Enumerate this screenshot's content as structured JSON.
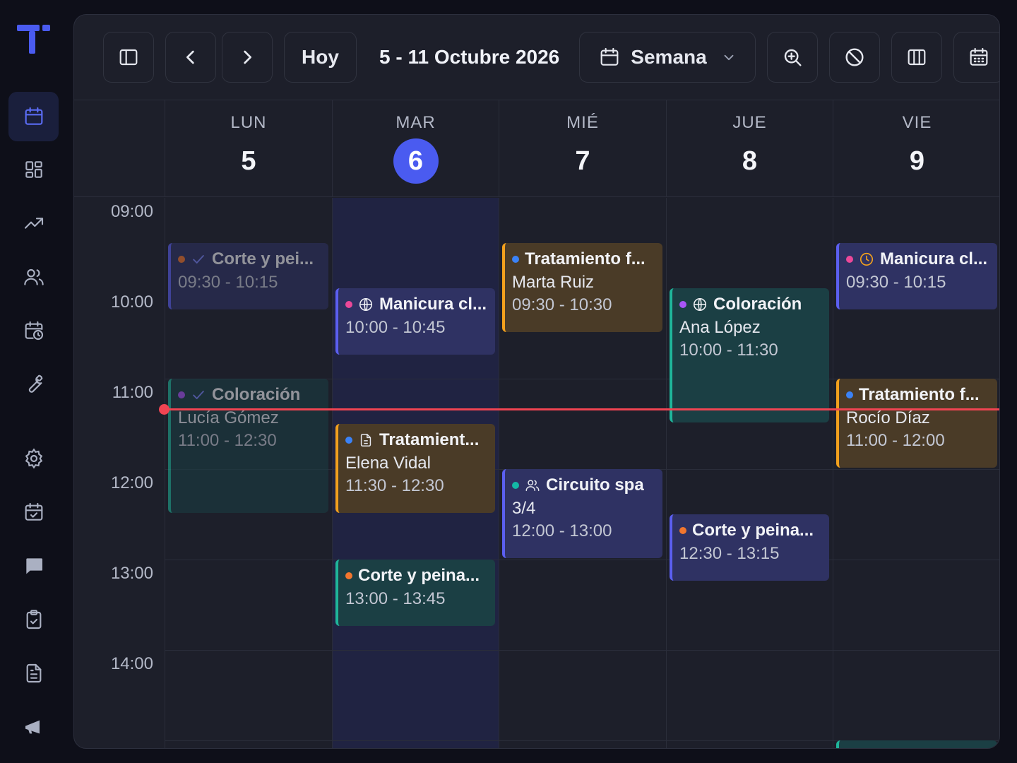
{
  "toolbar": {
    "today_label": "Hoy",
    "range_label": "5 - 11 Octubre 2026",
    "view_label": "Semana"
  },
  "days": [
    {
      "dow": "LUN",
      "num": "5"
    },
    {
      "dow": "MAR",
      "num": "6",
      "today": true
    },
    {
      "dow": "MIÉ",
      "num": "7"
    },
    {
      "dow": "JUE",
      "num": "8"
    },
    {
      "dow": "VIE",
      "num": "9"
    }
  ],
  "hours": [
    "09:00",
    "10:00",
    "11:00",
    "12:00",
    "13:00",
    "14:00"
  ],
  "events": {
    "mon_1": {
      "title": "Corte y pei...",
      "time": "09:30 - 10:15"
    },
    "mon_2": {
      "title": "Coloración",
      "client": "Lucía Gómez",
      "time": "11:00 - 12:30"
    },
    "tue_1": {
      "title": "Manicura cl...",
      "time": "10:00 - 10:45"
    },
    "tue_2": {
      "title": "Tratamient...",
      "client": "Elena Vidal",
      "time": "11:30 - 12:30"
    },
    "tue_3": {
      "title": "Corte y peina...",
      "time": "13:00 - 13:45"
    },
    "wed_1": {
      "title": "Tratamiento f...",
      "client": "Marta Ruiz",
      "time": "09:30 - 10:30"
    },
    "wed_2": {
      "title": "Circuito spa",
      "client": "3/4",
      "time": "12:00 - 13:00"
    },
    "thu_1": {
      "title": "Coloración",
      "client": "Ana López",
      "time": "10:00 - 11:30"
    },
    "thu_2": {
      "title": "Corte y peina...",
      "time": "12:30 - 13:15"
    },
    "fri_1": {
      "title": "Manicura cl...",
      "time": "09:30 - 10:15"
    },
    "fri_2": {
      "title": "Tratamiento f...",
      "client": "Rocío Díaz",
      "time": "11:00 - 12:00"
    }
  },
  "colors": {
    "accent": "#4a5bf0",
    "now_line": "#f04452",
    "dot_orange": "#f2762e",
    "dot_pink": "#ec4899",
    "dot_blue": "#3b82f6",
    "dot_purple": "#a855f7",
    "dot_teal": "#14b8a6"
  }
}
